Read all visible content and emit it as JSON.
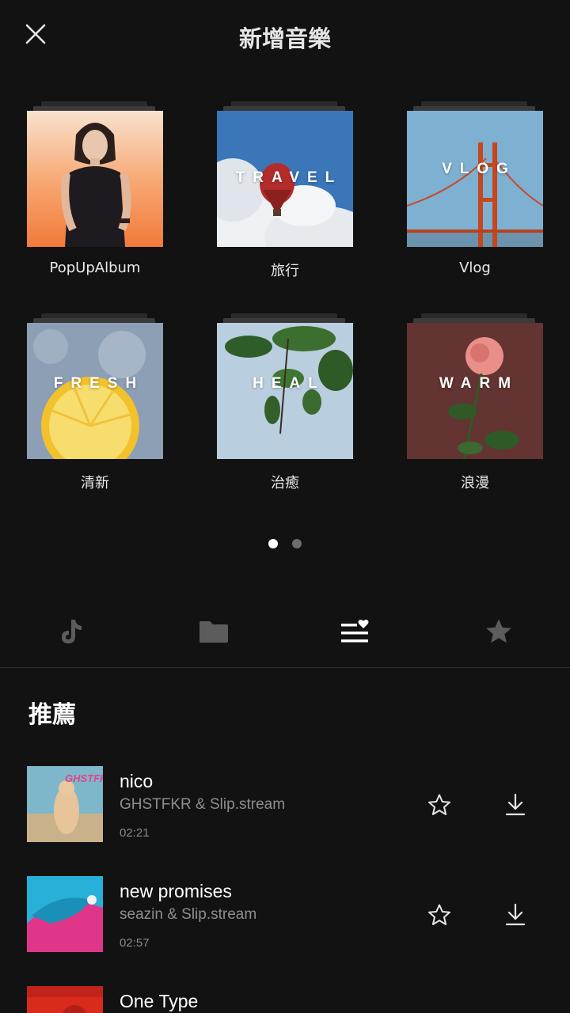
{
  "header": {
    "title": "新增音樂",
    "close_icon": "close-icon"
  },
  "albums": [
    {
      "label": "PopUpAlbum",
      "cover_text": ""
    },
    {
      "label": "旅行",
      "cover_text": "TRAVEL"
    },
    {
      "label": "Vlog",
      "cover_text": "VLOG"
    },
    {
      "label": "清新",
      "cover_text": "FRESH"
    },
    {
      "label": "治癒",
      "cover_text": "HEAL"
    },
    {
      "label": "浪漫",
      "cover_text": "WARM"
    }
  ],
  "pager": {
    "pages": 2,
    "active": 1
  },
  "tabs": [
    {
      "icon": "tiktok-icon",
      "active": false
    },
    {
      "icon": "folder-icon",
      "active": false
    },
    {
      "icon": "playlist-heart-icon",
      "active": true
    },
    {
      "icon": "star-icon",
      "active": false
    }
  ],
  "section": {
    "title": "推薦"
  },
  "tracks": [
    {
      "title": "nico",
      "artist": "GHSTFKR & Slip.stream",
      "duration": "02:21"
    },
    {
      "title": "new promises",
      "artist": "seazin & Slip.stream",
      "duration": "02:57"
    },
    {
      "title": "One Type",
      "artist": "",
      "duration": ""
    }
  ],
  "colors": {
    "background": "#121212",
    "text": "#ffffff",
    "secondary_text": "#8e8e8e",
    "inactive_icon": "#5c5c5c"
  }
}
